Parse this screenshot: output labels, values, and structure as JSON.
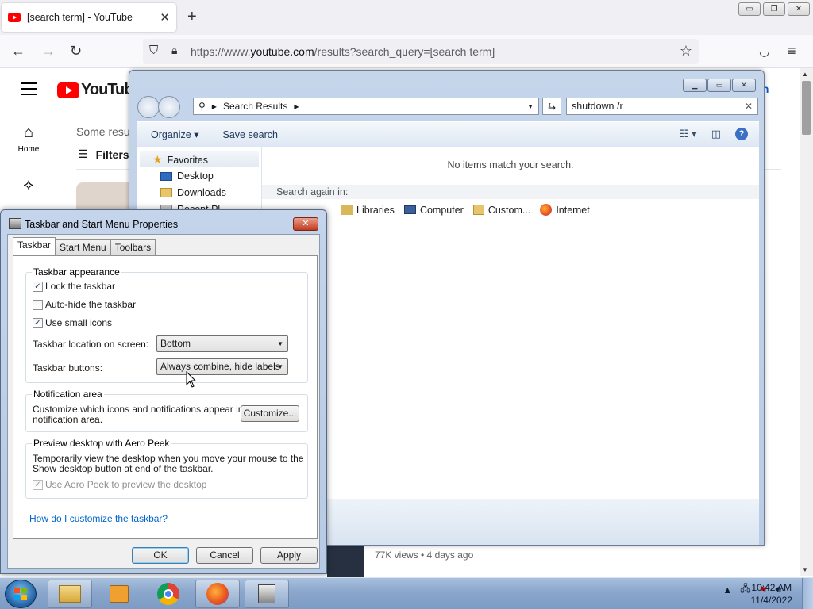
{
  "browser": {
    "tab_title": "[search term] - YouTube",
    "url_prefix": "https://www.",
    "url_host": "youtube.com",
    "url_path": "/results?search_query=[search term]",
    "close_glyph": "✕",
    "newtab_glyph": "+",
    "win_min": "▭",
    "win_restore": "❐",
    "win_close": "✕"
  },
  "youtube": {
    "logo_text": "YouTube",
    "side_home": "Home",
    "some_results": "Some resu",
    "filters": "Filters",
    "sign_in_fragment": "in",
    "video_meta": "77K views • 4 days ago"
  },
  "explorer": {
    "address_segment": "Search Results",
    "search_value": "shutdown /r",
    "toolbar": {
      "organize": "Organize",
      "save_search": "Save search"
    },
    "nav": {
      "favorites": "Favorites",
      "desktop": "Desktop",
      "downloads": "Downloads",
      "recent_fragment": "Recent Pl"
    },
    "no_items": "No items match your search.",
    "search_again": "Search again in:",
    "search_again_items": [
      {
        "label": "Libraries",
        "icon": "library-icon"
      },
      {
        "label": "Computer",
        "icon": "computer-icon"
      },
      {
        "label": "Custom...",
        "icon": "folder-icon"
      },
      {
        "label": "Internet",
        "icon": "firefox-icon"
      }
    ]
  },
  "dialog": {
    "title": "Taskbar and Start Menu Properties",
    "tabs": [
      "Taskbar",
      "Start Menu",
      "Toolbars"
    ],
    "appearance_group": "Taskbar appearance",
    "lock_taskbar": "Lock the taskbar",
    "auto_hide": "Auto-hide the taskbar",
    "small_icons": "Use small icons",
    "location_label": "Taskbar location on screen:",
    "location_value": "Bottom",
    "buttons_label": "Taskbar buttons:",
    "buttons_value": "Always combine, hide labels",
    "notif_group": "Notification area",
    "notif_desc_1": "Customize which icons and notifications appear in the",
    "notif_desc_2": "notification area.",
    "customize_btn": "Customize...",
    "peek_group": "Preview desktop with Aero Peek",
    "peek_desc_1": "Temporarily view the desktop when you move your mouse to the",
    "peek_desc_2": "Show desktop button at end of the taskbar.",
    "peek_checkbox": "Use Aero Peek to preview the desktop",
    "help_link": "How do I customize the taskbar?",
    "ok": "OK",
    "cancel": "Cancel",
    "apply": "Apply",
    "checked": {
      "lock": true,
      "autohide": false,
      "small": true,
      "peek": true
    }
  },
  "taskbar": {
    "clock_time": "10:42 AM",
    "clock_date": "11/4/2022"
  },
  "colors": {
    "youtube_red": "#ff0000",
    "win7_taskbar": "#8aa6cc",
    "link_blue": "#0066cc"
  }
}
